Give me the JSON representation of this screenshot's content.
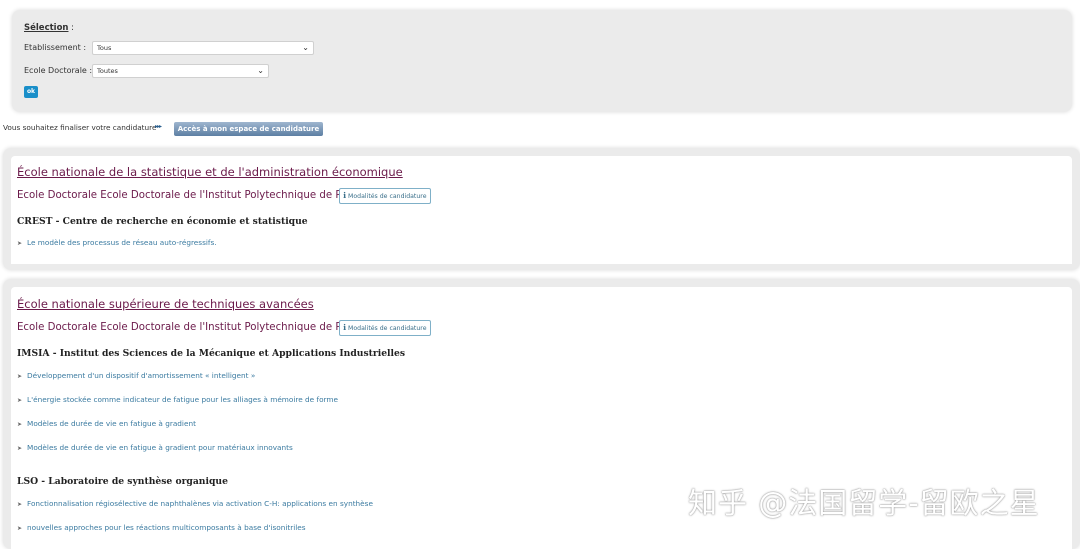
{
  "selection": {
    "title": "Sélection",
    "title_suffix": " :",
    "establishment_label": "Etablissement :",
    "establishment_value": "Tous",
    "doctoral_label": "Ecole Doctorale :",
    "doctoral_value": "Toutes",
    "ok_label": "ok"
  },
  "finalise": {
    "text": "Vous souhaitez finaliser votre candidature",
    "arrows": "▸▸▸",
    "button_label": "Accès à mon espace de candidature"
  },
  "cards": [
    {
      "school": "École nationale de la statistique et de l'administration économique",
      "doctoral_school": "Ecole Doctorale Ecole Doctorale de l'Institut Polytechnique de Paris",
      "modalites_label": "Modalités de candidature",
      "labs": [
        {
          "name": "CREST - Centre de recherche en économie et statistique",
          "topics": [
            "Le modèle des processus de réseau auto-régressifs."
          ]
        }
      ]
    },
    {
      "school": "École nationale supérieure de techniques avancées",
      "doctoral_school": "Ecole Doctorale Ecole Doctorale de l'Institut Polytechnique de Paris",
      "modalites_label": "Modalités de candidature",
      "labs": [
        {
          "name": "IMSIA - Institut des Sciences de la Mécanique et Applications Industrielles",
          "topics": [
            "Développement d'un dispositif d'amortissement « intelligent »",
            "L'énergie stockée comme indicateur de fatigue pour les alliages à mémoire de forme",
            "Modèles de durée de vie en fatigue à gradient",
            "Modèles de durée de vie en fatigue à gradient pour matériaux innovants"
          ]
        },
        {
          "name": "LSO - Laboratoire de synthèse organique",
          "topics": [
            "Fonctionnalisation régiosélective de naphthalènes via activation C-H: applications en synthèse",
            "nouvelles approches pour les réactions multicomposants à base d'isonitriles"
          ]
        }
      ]
    }
  ],
  "icons": {
    "info": "ℹ",
    "bullet": "➤",
    "chevron": "⌄"
  },
  "watermark": "知乎 @法国留学-留欧之星",
  "colors": {
    "school_link": "#6b1a4a",
    "topic_link": "#3a7aa0",
    "ok_button": "#1a8fc9",
    "panel_bg": "#ebebeb"
  }
}
